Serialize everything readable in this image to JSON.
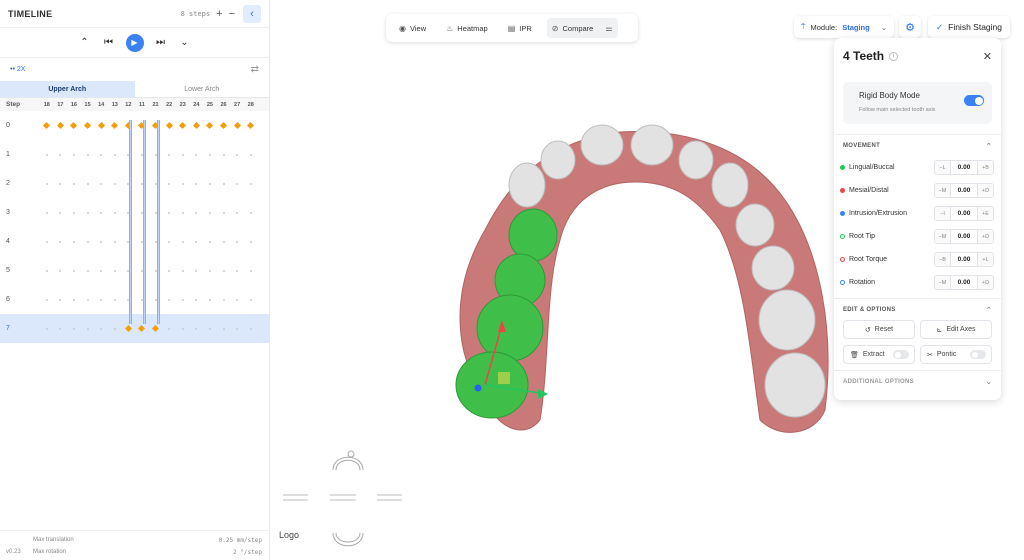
{
  "timeline": {
    "title": "TIMELINE",
    "steps_badge": "8 steps",
    "plus": "+",
    "minus": "−",
    "speed": "2X",
    "tabs": [
      "Upper Arch",
      "Lower Arch"
    ],
    "step_header": "Step",
    "teeth": [
      "18",
      "17",
      "16",
      "15",
      "14",
      "13",
      "12",
      "11",
      "21",
      "22",
      "23",
      "24",
      "25",
      "26",
      "27",
      "28"
    ],
    "steps": [
      "0",
      "1",
      "2",
      "3",
      "4",
      "5",
      "6",
      "7"
    ],
    "selected_step": "7",
    "footer": {
      "version": "v0.23",
      "max_translation_label": "Max translation",
      "max_translation_value": "0.25 mm/step",
      "max_rotation_label": "Max rotation",
      "max_rotation_value": "2 °/step"
    }
  },
  "toolbar": {
    "view": "View",
    "heatmap": "Heatmap",
    "ipr": "IPR",
    "compare": "Compare"
  },
  "module": {
    "label": "Module:",
    "value": "Staging"
  },
  "finish": "Finish Staging",
  "panel": {
    "title": "4 Teeth",
    "rigid_title": "Rigid Body Mode",
    "rigid_sub": "Follow main selected tooth axis",
    "movement_header": "MOVEMENT",
    "movements": [
      {
        "label": "Lingual/Buccal",
        "minus": "−L",
        "value": "0.00",
        "plus": "+B",
        "color": "#22c55e",
        "ring": false
      },
      {
        "label": "Mesial/Distal",
        "minus": "−M",
        "value": "0.00",
        "plus": "+D",
        "color": "#ef4444",
        "ring": false
      },
      {
        "label": "Intrusion/Extrusion",
        "minus": "−I",
        "value": "0.00",
        "plus": "+E",
        "color": "#3b82f6",
        "ring": false
      },
      {
        "label": "Root Tip",
        "minus": "−M",
        "value": "0.00",
        "plus": "+D",
        "color": "#22c55e",
        "ring": true
      },
      {
        "label": "Root Torque",
        "minus": "−B",
        "value": "0.00",
        "plus": "+L",
        "color": "#ef4444",
        "ring": true
      },
      {
        "label": "Rotation",
        "minus": "−M",
        "value": "0.00",
        "plus": "+D",
        "color": "#3b82f6",
        "ring": true
      }
    ],
    "edit_header": "EDIT & OPTIONS",
    "reset": "Reset",
    "edit_axes": "Edit Axes",
    "extract": "Extract",
    "pontic": "Pontic",
    "additional_header": "ADDITIONAL OPTIONS"
  },
  "logo": "Logo",
  "colors": {
    "accent": "#3b82f6",
    "gum": "#c97a78",
    "tooth": "#e2e2e2",
    "selected_tooth": "#3fbf4a",
    "keyframe": "#f59e0b"
  }
}
